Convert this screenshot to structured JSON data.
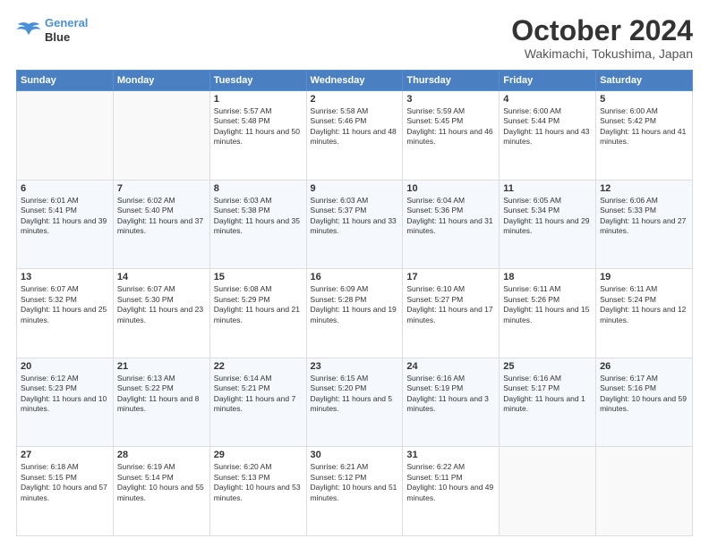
{
  "header": {
    "logo_line1": "General",
    "logo_line2": "Blue",
    "month": "October 2024",
    "location": "Wakimachi, Tokushima, Japan"
  },
  "days_of_week": [
    "Sunday",
    "Monday",
    "Tuesday",
    "Wednesday",
    "Thursday",
    "Friday",
    "Saturday"
  ],
  "weeks": [
    [
      {
        "day": "",
        "text": ""
      },
      {
        "day": "",
        "text": ""
      },
      {
        "day": "1",
        "text": "Sunrise: 5:57 AM\nSunset: 5:48 PM\nDaylight: 11 hours and 50 minutes."
      },
      {
        "day": "2",
        "text": "Sunrise: 5:58 AM\nSunset: 5:46 PM\nDaylight: 11 hours and 48 minutes."
      },
      {
        "day": "3",
        "text": "Sunrise: 5:59 AM\nSunset: 5:45 PM\nDaylight: 11 hours and 46 minutes."
      },
      {
        "day": "4",
        "text": "Sunrise: 6:00 AM\nSunset: 5:44 PM\nDaylight: 11 hours and 43 minutes."
      },
      {
        "day": "5",
        "text": "Sunrise: 6:00 AM\nSunset: 5:42 PM\nDaylight: 11 hours and 41 minutes."
      }
    ],
    [
      {
        "day": "6",
        "text": "Sunrise: 6:01 AM\nSunset: 5:41 PM\nDaylight: 11 hours and 39 minutes."
      },
      {
        "day": "7",
        "text": "Sunrise: 6:02 AM\nSunset: 5:40 PM\nDaylight: 11 hours and 37 minutes."
      },
      {
        "day": "8",
        "text": "Sunrise: 6:03 AM\nSunset: 5:38 PM\nDaylight: 11 hours and 35 minutes."
      },
      {
        "day": "9",
        "text": "Sunrise: 6:03 AM\nSunset: 5:37 PM\nDaylight: 11 hours and 33 minutes."
      },
      {
        "day": "10",
        "text": "Sunrise: 6:04 AM\nSunset: 5:36 PM\nDaylight: 11 hours and 31 minutes."
      },
      {
        "day": "11",
        "text": "Sunrise: 6:05 AM\nSunset: 5:34 PM\nDaylight: 11 hours and 29 minutes."
      },
      {
        "day": "12",
        "text": "Sunrise: 6:06 AM\nSunset: 5:33 PM\nDaylight: 11 hours and 27 minutes."
      }
    ],
    [
      {
        "day": "13",
        "text": "Sunrise: 6:07 AM\nSunset: 5:32 PM\nDaylight: 11 hours and 25 minutes."
      },
      {
        "day": "14",
        "text": "Sunrise: 6:07 AM\nSunset: 5:30 PM\nDaylight: 11 hours and 23 minutes."
      },
      {
        "day": "15",
        "text": "Sunrise: 6:08 AM\nSunset: 5:29 PM\nDaylight: 11 hours and 21 minutes."
      },
      {
        "day": "16",
        "text": "Sunrise: 6:09 AM\nSunset: 5:28 PM\nDaylight: 11 hours and 19 minutes."
      },
      {
        "day": "17",
        "text": "Sunrise: 6:10 AM\nSunset: 5:27 PM\nDaylight: 11 hours and 17 minutes."
      },
      {
        "day": "18",
        "text": "Sunrise: 6:11 AM\nSunset: 5:26 PM\nDaylight: 11 hours and 15 minutes."
      },
      {
        "day": "19",
        "text": "Sunrise: 6:11 AM\nSunset: 5:24 PM\nDaylight: 11 hours and 12 minutes."
      }
    ],
    [
      {
        "day": "20",
        "text": "Sunrise: 6:12 AM\nSunset: 5:23 PM\nDaylight: 11 hours and 10 minutes."
      },
      {
        "day": "21",
        "text": "Sunrise: 6:13 AM\nSunset: 5:22 PM\nDaylight: 11 hours and 8 minutes."
      },
      {
        "day": "22",
        "text": "Sunrise: 6:14 AM\nSunset: 5:21 PM\nDaylight: 11 hours and 7 minutes."
      },
      {
        "day": "23",
        "text": "Sunrise: 6:15 AM\nSunset: 5:20 PM\nDaylight: 11 hours and 5 minutes."
      },
      {
        "day": "24",
        "text": "Sunrise: 6:16 AM\nSunset: 5:19 PM\nDaylight: 11 hours and 3 minutes."
      },
      {
        "day": "25",
        "text": "Sunrise: 6:16 AM\nSunset: 5:17 PM\nDaylight: 11 hours and 1 minute."
      },
      {
        "day": "26",
        "text": "Sunrise: 6:17 AM\nSunset: 5:16 PM\nDaylight: 10 hours and 59 minutes."
      }
    ],
    [
      {
        "day": "27",
        "text": "Sunrise: 6:18 AM\nSunset: 5:15 PM\nDaylight: 10 hours and 57 minutes."
      },
      {
        "day": "28",
        "text": "Sunrise: 6:19 AM\nSunset: 5:14 PM\nDaylight: 10 hours and 55 minutes."
      },
      {
        "day": "29",
        "text": "Sunrise: 6:20 AM\nSunset: 5:13 PM\nDaylight: 10 hours and 53 minutes."
      },
      {
        "day": "30",
        "text": "Sunrise: 6:21 AM\nSunset: 5:12 PM\nDaylight: 10 hours and 51 minutes."
      },
      {
        "day": "31",
        "text": "Sunrise: 6:22 AM\nSunset: 5:11 PM\nDaylight: 10 hours and 49 minutes."
      },
      {
        "day": "",
        "text": ""
      },
      {
        "day": "",
        "text": ""
      }
    ]
  ]
}
